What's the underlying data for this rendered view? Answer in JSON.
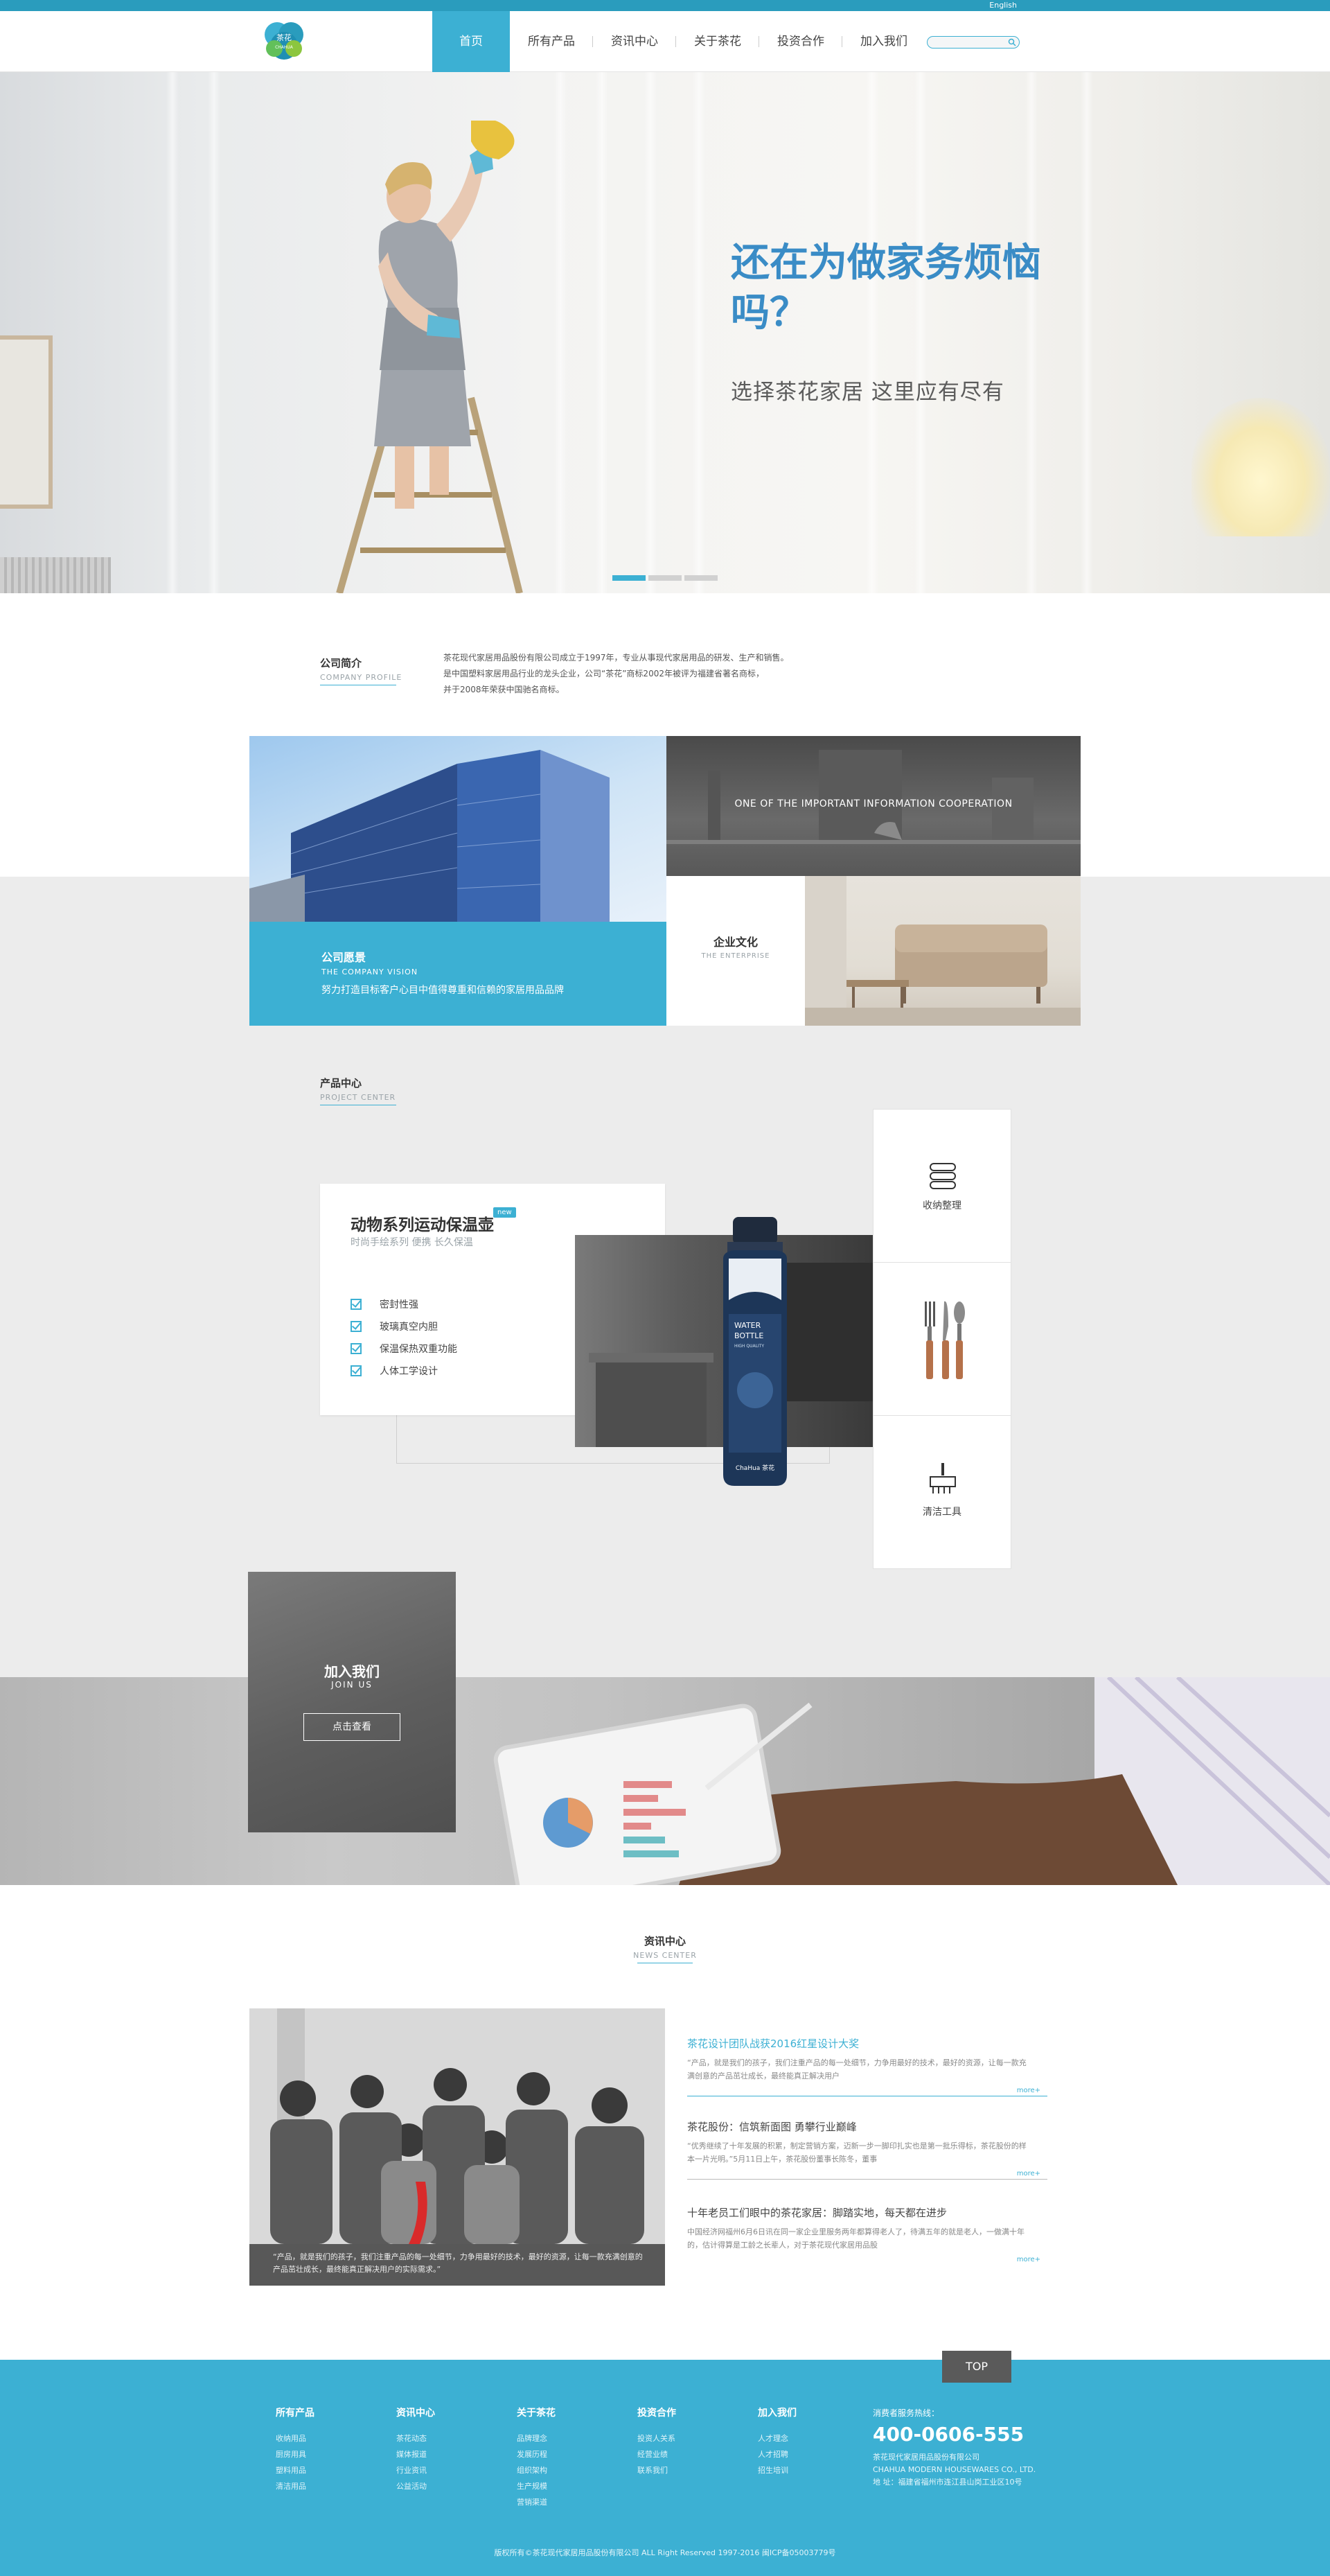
{
  "topbar": {
    "language": "English"
  },
  "header": {
    "logo_cn": "茶花",
    "logo_en": "CHAHUA",
    "nav": [
      {
        "label": "首页"
      },
      {
        "label": "所有产品"
      },
      {
        "label": "资讯中心"
      },
      {
        "label": "关于茶花"
      },
      {
        "label": "投资合作"
      },
      {
        "label": "加入我们"
      }
    ],
    "search_placeholder": ""
  },
  "hero": {
    "title": "还在为做家务烦恼吗？",
    "subtitle": "选择茶花家居 这里应有尽有",
    "slides": 3,
    "active_slide": 1
  },
  "profile": {
    "title": "公司简介",
    "title_en": "COMPANY PROFILE",
    "text_lines": [
      "茶花现代家居用品股份有限公司成立于1997年，专业从事现代家居用品的研发、生产和销售。",
      "是中国塑料家居用品行业的龙头企业，公司“茶花”商标2002年被评为福建省著名商标，",
      "并于2008年荣获中国驰名商标。"
    ]
  },
  "about": {
    "vision_title": "公司愿景",
    "vision_en": "THE COMPANY VISION",
    "vision_desc": "努力打造目标客户心目中值得尊重和信赖的家居用品品牌",
    "coop_text": "ONE OF THE IMPORTANT INFORMATION COOPERATION",
    "culture_title": "企业文化",
    "culture_en": "THE ENTERPRISE"
  },
  "products": {
    "title": "产品中心",
    "title_en": "PROJECT CENTER",
    "card_name": "动物系列运动保温壶",
    "badge": "new",
    "card_desc": "时尚手绘系列  便携  长久保温",
    "features": [
      "密封性强",
      "玻璃真空内胆",
      "保温保热双重功能",
      "人体工学设计"
    ],
    "bottle_text": [
      "WATER",
      "BOTTLE",
      "HIGH QUALITY",
      "ChaHua 茶花"
    ],
    "categories": [
      {
        "label": "收纳整理",
        "icon": "storage-icon"
      },
      {
        "label": "",
        "icon": "cutlery-icon"
      },
      {
        "label": "清洁工具",
        "icon": "broom-icon"
      }
    ]
  },
  "join": {
    "title": "加入我们",
    "title_en": "JOIN US",
    "button": "点击查看"
  },
  "news": {
    "title": "资讯中心",
    "title_en": "NEWS CENTER",
    "caption": "“产品，就是我们的孩子，我们注重产品的每一处细节，力争用最好的技术，最好的资源，让每一款充满创意的产品茁壮成长，最终能真正解决用户的实际需求。”",
    "items": [
      {
        "title": "茶花设计团队战获2016红星设计大奖",
        "body": "“产品，就是我们的孩子，我们注重产品的每一处细节，力争用最好的技术，最好的资源，让每一款充满创意的产品茁壮成长，最终能真正解决用户",
        "more": "more+"
      },
      {
        "title": "茶花股份：信筑新面图 勇攀行业巅峰",
        "body": "“优秀继续了十年发展的积累，制定营销方案，迈新一步一脚印扎实也是第一批乐得标，茶花股份的样本一片光明。”5月11日上午，茶花股份董事长陈冬，董事",
        "more": "more+"
      },
      {
        "title": "十年老员工们眼中的茶花家居：脚踏实地，每天都在进步",
        "body": "中国经济网福州6月6日讯在同一家企业里服务两年都算得老人了，待满五年的就是老人，一做满十年的，估计得算是工龄之长辈人，对于茶花现代家居用品股",
        "more": "more+"
      }
    ]
  },
  "footer": {
    "top_button": "TOP",
    "columns": [
      {
        "heading": "所有产品",
        "items": [
          "收纳用品",
          "厨房用具",
          "塑料用品",
          "清洁用品"
        ]
      },
      {
        "heading": "资讯中心",
        "items": [
          "茶花动态",
          "媒体报道",
          "行业资讯",
          "公益活动"
        ]
      },
      {
        "heading": "关于茶花",
        "items": [
          "品牌理念",
          "发展历程",
          "组织架构",
          "生产规模",
          "营销渠道"
        ]
      },
      {
        "heading": "投资合作",
        "items": [
          "投资人关系",
          "经营业绩",
          "联系我们"
        ]
      },
      {
        "heading": "加入我们",
        "items": [
          "人才理念",
          "人才招聘",
          "招生培训"
        ]
      }
    ],
    "hotline_label": "消费者服务热线：",
    "hotline": "400-0606-555",
    "company_cn": "茶花现代家居用品股份有限公司",
    "company_en": "CHAHUA MODERN HOUSEWARES CO., LTD.",
    "address": "地    址：福建省福州市连江县山岗工业区10号",
    "copyright": "版权所有©茶花现代家居用品股份有限公司 ALL Right Reserved 1997-2016 闽ICP备05003779号"
  },
  "colors": {
    "brand": "#3cb0d3",
    "dark_bar": "#2a9cbd",
    "gray_band": "#ececec",
    "hero_title": "#3a8cc6"
  }
}
